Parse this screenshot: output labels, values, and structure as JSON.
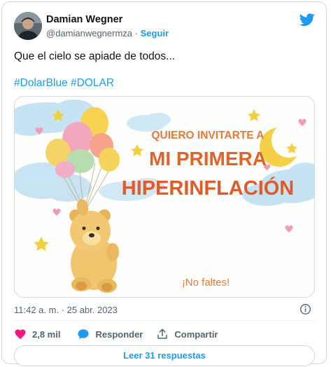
{
  "author": {
    "name": "Damian Wegner",
    "handle": "@damianwegnermza",
    "separator": "·",
    "follow_label": "Seguir"
  },
  "tweet": {
    "text": "Que el cielo se apiade de todos...",
    "hashtags": [
      "#DolarBlue",
      "#DOLAR"
    ]
  },
  "image": {
    "line1": "QUIERO INVITARTE A",
    "line2": "MI PRIMERA",
    "line3": "HIPERINFLACIÓN",
    "line4": "¡No faltes!"
  },
  "meta": {
    "timestamp": "11:42 a. m. · 25 abr. 2023"
  },
  "actions": {
    "likes": "2,8 mil",
    "reply_label": "Responder",
    "share_label": "Compartir"
  },
  "replies": {
    "label": "Leer 31 respuestas"
  },
  "colors": {
    "accent": "#1d9bf0",
    "like": "#f91880",
    "text": "#0f1419",
    "muted": "#536471",
    "title_orange": "#e0632a"
  },
  "icons": [
    "twitter-logo-icon",
    "info-icon",
    "heart-icon",
    "reply-bubble-icon",
    "share-icon",
    "moon-icon",
    "star-icon",
    "balloon-icon",
    "teddy-bear-icon"
  ]
}
